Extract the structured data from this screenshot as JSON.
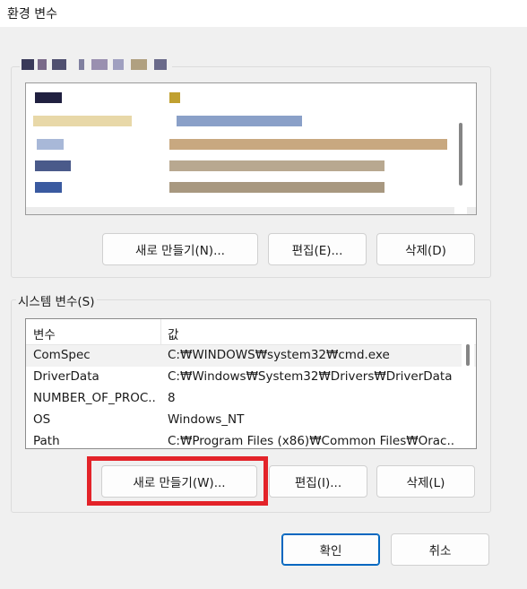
{
  "window": {
    "title": "환경 변수"
  },
  "user_section": {
    "label": "사용자 변수 (흐림 처리됨)",
    "buttons": {
      "new": "새로 만들기(N)...",
      "edit": "편집(E)...",
      "delete": "삭제(D)"
    }
  },
  "system_section": {
    "label": "시스템 변수(S)",
    "columns": {
      "variable": "변수",
      "value": "값"
    },
    "rows": [
      {
        "name": "ComSpec",
        "value": "C:₩WINDOWS₩system32₩cmd.exe"
      },
      {
        "name": "DriverData",
        "value": "C:₩Windows₩System32₩Drivers₩DriverData"
      },
      {
        "name": "NUMBER_OF_PROC...",
        "value": "8"
      },
      {
        "name": "OS",
        "value": "Windows_NT"
      },
      {
        "name": "Path",
        "value": "C:₩Program Files (x86)₩Common Files₩Orac..."
      }
    ],
    "buttons": {
      "new": "새로 만들기(W)...",
      "edit": "편집(I)...",
      "delete": "삭제(L)"
    }
  },
  "dialog_buttons": {
    "ok": "확인",
    "cancel": "취소"
  },
  "colors": {
    "highlight": "#e32329",
    "selected_row": "#f2f2f2",
    "accent": "#0067c0"
  }
}
